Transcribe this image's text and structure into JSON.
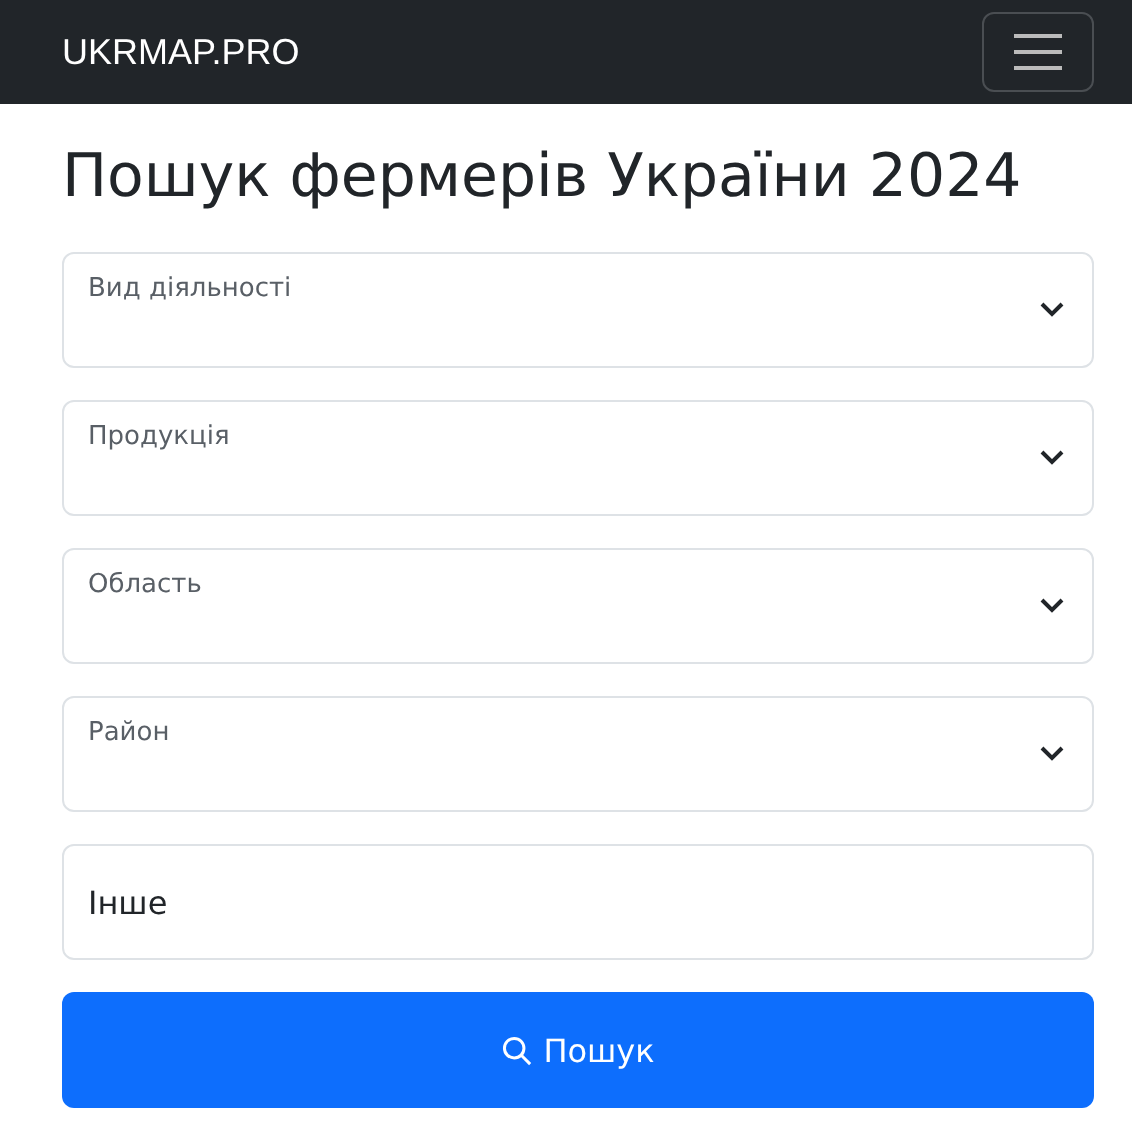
{
  "navbar": {
    "brand": "UKRMAP.PRO"
  },
  "title": "Пошук фермерів України 2024",
  "filters": [
    {
      "label": "Вид діяльності"
    },
    {
      "label": "Продукція"
    },
    {
      "label": "Область"
    },
    {
      "label": "Район"
    }
  ],
  "other_field": {
    "value": "Інше"
  },
  "search_button": {
    "label": "Пошук"
  }
}
